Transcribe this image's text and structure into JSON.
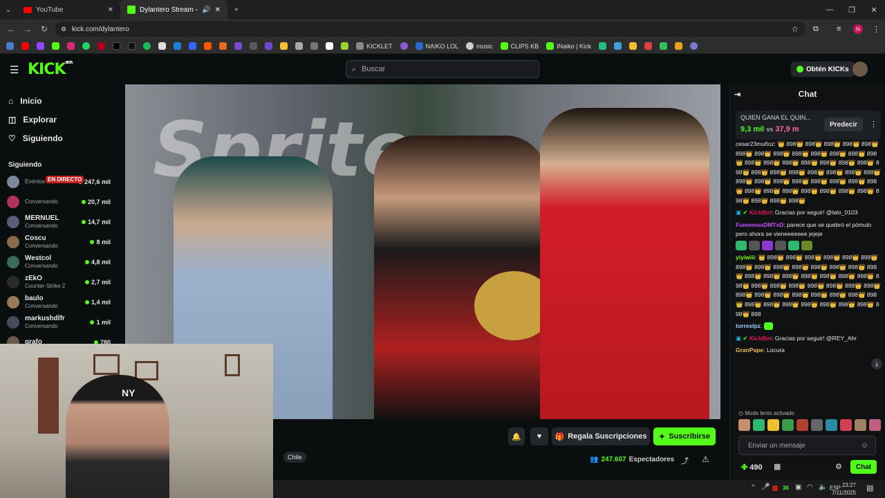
{
  "browser": {
    "tabs": [
      {
        "title": "YouTube",
        "active": false
      },
      {
        "title": "Dylantero Stream - Watch L",
        "active": true
      }
    ],
    "url": "kick.com/dylantero",
    "bookmarks": [
      "KICKLET",
      "NAIKO LOL",
      "music",
      "CLIPS KB",
      "INaiko | Kick"
    ]
  },
  "header": {
    "logo": "KICK",
    "logo_tag": "BETA",
    "search_placeholder": "Buscar",
    "kicks_button": "Obtén KICKs"
  },
  "sidebar": {
    "nav": [
      {
        "label": "Inicio",
        "icon": "home-icon"
      },
      {
        "label": "Explorar",
        "icon": "compass-icon"
      },
      {
        "label": "Siguiendo",
        "icon": "heart-icon"
      }
    ],
    "section_title": "Siguiendo",
    "live_badge": "EN DIRECTO",
    "channels": [
      {
        "name": "",
        "status": "Eventos especia...",
        "viewers": "247,6 mil",
        "color": "#7a8a9a"
      },
      {
        "name": "",
        "status": "Conversando",
        "viewers": "20,7 mil",
        "color": "#b03060"
      },
      {
        "name": "MERNUEL",
        "status": "Conversando",
        "viewers": "14,7 mil",
        "color": "#5a5a7a"
      },
      {
        "name": "Coscu",
        "status": "Conversando",
        "viewers": "8 mil",
        "color": "#8a6a4a"
      },
      {
        "name": "Westcol",
        "status": "Conversando",
        "viewers": "4,8 mil",
        "color": "#3a6a5a"
      },
      {
        "name": "zEkO",
        "status": "Counter-Strike 2",
        "viewers": "2,7 mil",
        "color": "#2a2a2a"
      },
      {
        "name": "baulo",
        "status": "Conversando",
        "viewers": "1,4 mil",
        "color": "#9a7a5a"
      },
      {
        "name": "markushdlfr",
        "status": "Conversando",
        "viewers": "1 mil",
        "color": "#4a4a5a"
      },
      {
        "name": "grafo",
        "status": "",
        "viewers": "780",
        "color": "#6a5a4a"
      }
    ]
  },
  "video": {
    "overlay_text": "Sprite"
  },
  "below_video": {
    "gift_button": "Regala Suscripciones",
    "subscribe_button": "Suscribirse",
    "tag": "Chile",
    "viewers_count": "247.607",
    "viewers_label": "Espectadores"
  },
  "chat": {
    "title": "Chat",
    "prediction": {
      "question": "QUIEN GANA EL QUIN...",
      "left_value": "9,3 mil",
      "vs": "vs",
      "right_value": "37,9 m",
      "button": "Predecir"
    },
    "spam_top": "cesar23muñoz: 👑 898👑 898👑 898👑 898👑 898👑 898👑 898👑 898👑 898👑 898👑 898👑 898👑 898👑 898👑 898👑 898👑 898👑 898👑 898👑 898👑 898👑 898👑 898👑 898👑 898👑 898👑 898👑 898👑 898👑 898👑 898👑 898👑 898👑 898👑 898👑 898👑 898👑 898👑 898👑 898👑 898👑 898👑 898👑 898👑 898👑 898👑 898👑",
    "messages": [
      {
        "user": "KickBot",
        "color": "#e9115b",
        "text": "Gracias por seguir! @lalo_0103"
      },
      {
        "user": "FumemosDMTxD",
        "color": "#c34dff",
        "text": "parece que se quebró el pómulo pero ahora se vieneeeeeee jejeje"
      },
      {
        "user": "yiyiwiii",
        "color": "#7fff00",
        "text": "👑 898👑 898👑 898👑 898👑 898👑 898👑 898👑 898👑 898👑 898👑 898👑 898👑 898👑 898👑 898👑 898👑 898👑 898👑 898👑 898👑 898👑 898👑 898👑 898👑 898👑 898👑 898👑 898👑 898👑 898👑 898👑 898👑 898👑 898👑 898👑 898👑 898👑 898👑 898👑 898👑 898👑 898👑 898👑 898👑 898👑 898"
      },
      {
        "user": "torreslpz",
        "color": "#9ad0ff",
        "text": ""
      },
      {
        "user": "KickBot",
        "color": "#e9115b",
        "text": "Gracias por seguir! @REY_Ahr"
      },
      {
        "user": "GranPape",
        "color": "#f2c14e",
        "text": "Locura"
      }
    ],
    "slow_mode": "Modo lento activado",
    "input_placeholder": "Enviar un mensaje",
    "points": "490",
    "chat_button": "Chat"
  },
  "taskbar": {
    "lang": "ESP",
    "time": "23:27",
    "date": "7/11/2025",
    "number": "36"
  }
}
